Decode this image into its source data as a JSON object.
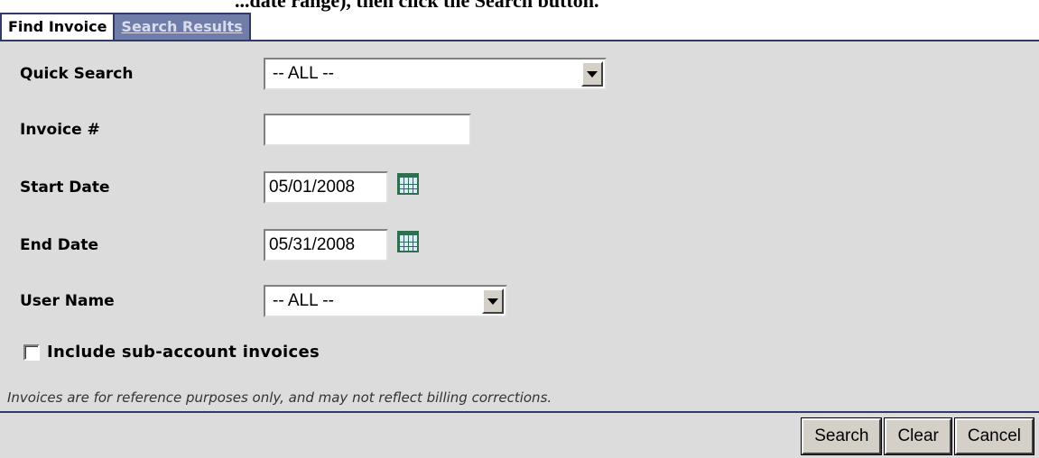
{
  "header_fragment": "...date range), then click the Search button.",
  "tabs": [
    {
      "label": "Find Invoice",
      "active": true
    },
    {
      "label": "Search Results",
      "active": false
    }
  ],
  "form": {
    "quick_search": {
      "label": "Quick Search",
      "value": "-- ALL --"
    },
    "invoice_number": {
      "label": "Invoice #",
      "value": ""
    },
    "start_date": {
      "label": "Start Date",
      "value": "05/01/2008",
      "icon": "calendar-icon"
    },
    "end_date": {
      "label": "End Date",
      "value": "05/31/2008",
      "icon": "calendar-icon"
    },
    "user_name": {
      "label": "User Name",
      "value": "-- ALL --"
    },
    "include_sub_accounts": {
      "label": "Include sub-account invoices",
      "checked": false
    }
  },
  "note": "Invoices are for reference purposes only, and may not reflect billing corrections.",
  "buttons": {
    "search": "Search",
    "clear": "Clear",
    "cancel": "Cancel"
  },
  "colors": {
    "panel_bg": "#dcdcdc",
    "border": "#2f3a68",
    "inactive_tab": "#6f7da8"
  }
}
